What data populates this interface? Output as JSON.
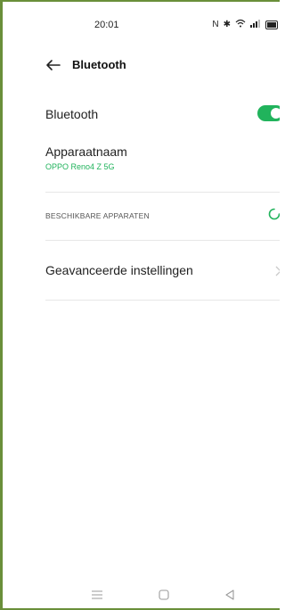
{
  "status": {
    "time": "20:01",
    "icons": [
      "nfc-icon",
      "bluetooth-icon",
      "wifi-icon",
      "signal-icon",
      "battery-icon"
    ]
  },
  "header": {
    "back_icon": "arrow-left-icon",
    "title": "Bluetooth"
  },
  "bluetooth": {
    "label": "Bluetooth",
    "enabled": true
  },
  "device_name": {
    "label": "Apparaatnaam",
    "value": "OPPO Reno4 Z 5G"
  },
  "available": {
    "label": "BESCHIKBARE APPARATEN",
    "scanning": true
  },
  "advanced": {
    "label": "Geavanceerde instellingen"
  },
  "nav": {
    "items": [
      "menu-icon",
      "home-icon",
      "back-triangle-icon"
    ]
  },
  "colors": {
    "accent": "#21b35c",
    "frame": "#6a8f3a",
    "text": "#1f1f1f"
  }
}
